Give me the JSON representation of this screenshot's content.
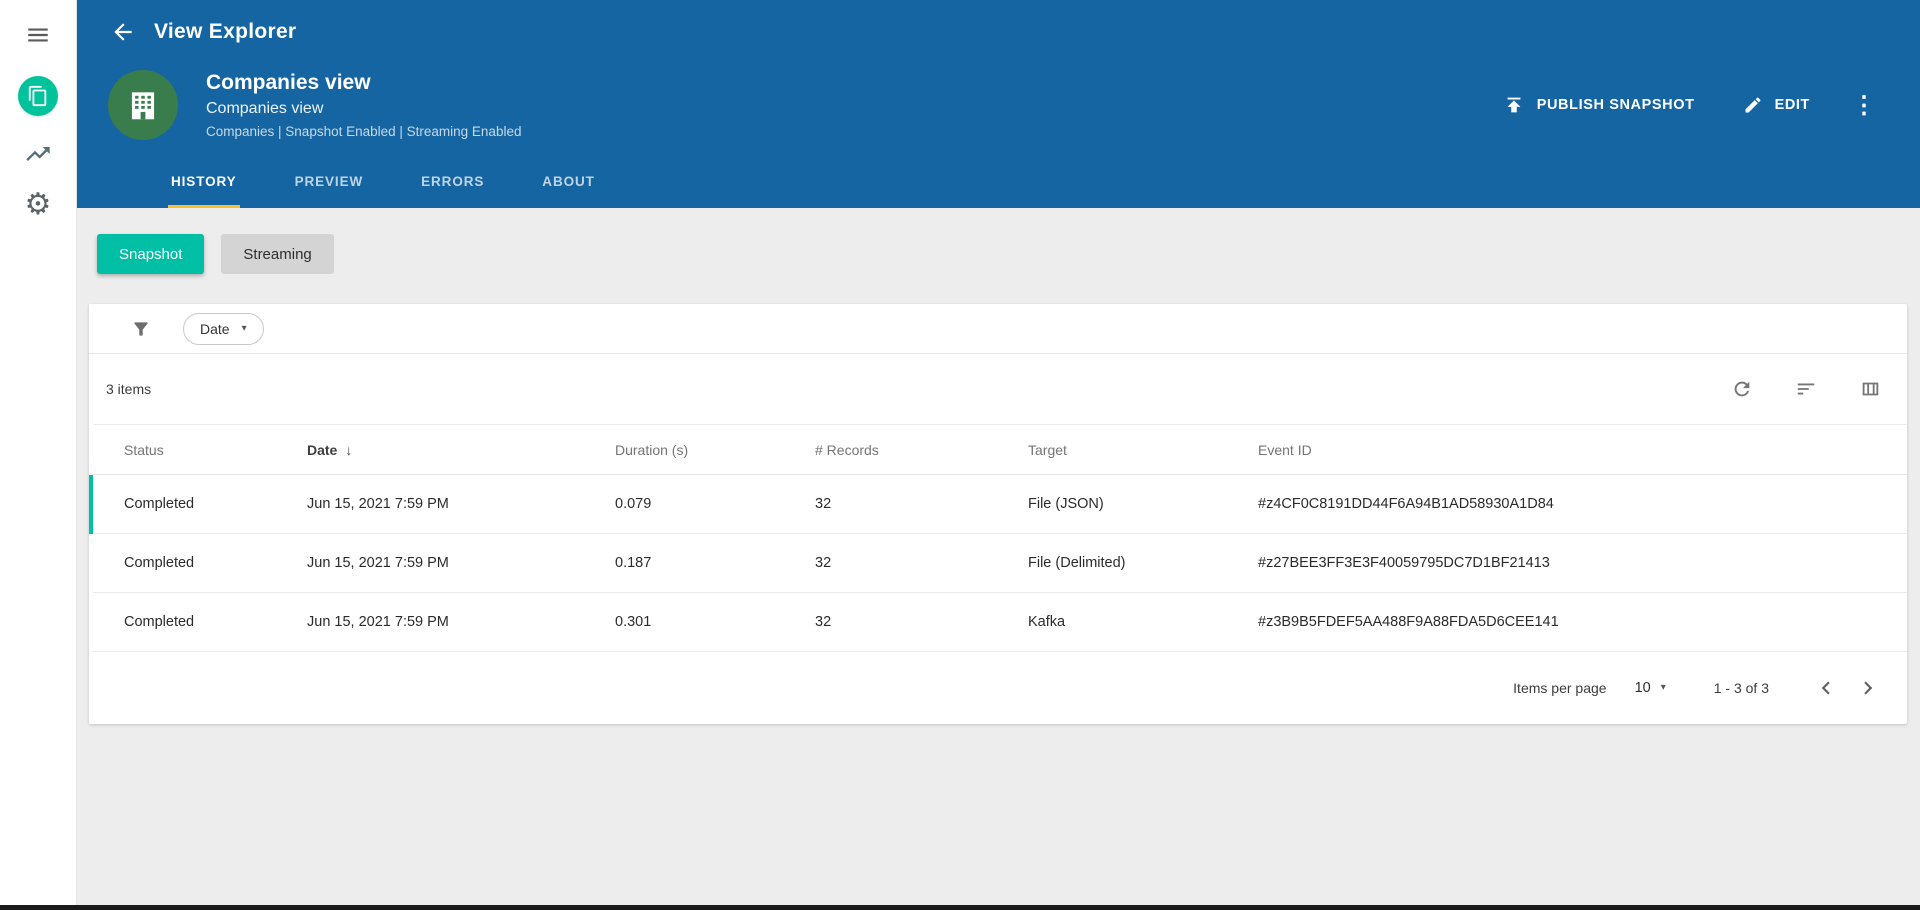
{
  "colors": {
    "header_blue": "#1565a3",
    "accent_teal": "#00bfa5",
    "tab_underline_yellow": "#fbc02d",
    "avatar_green": "#3a7d4c",
    "selected_row_indicator": "#00bfa5"
  },
  "glyphs": {
    "gear": "⚙",
    "kebab": "⋮",
    "caret_down": "▾",
    "sort_desc": "↓"
  },
  "header": {
    "app_title": "View Explorer",
    "view_name": "Companies view",
    "view_subtitle": "Companies view",
    "view_meta": "Companies | Snapshot Enabled | Streaming Enabled",
    "actions": {
      "publish_label": "PUBLISH SNAPSHOT",
      "edit_label": "EDIT"
    },
    "tabs": [
      {
        "label": "HISTORY"
      },
      {
        "label": "PREVIEW"
      },
      {
        "label": "ERRORS"
      },
      {
        "label": "ABOUT"
      }
    ]
  },
  "toggles": {
    "snapshot": "Snapshot",
    "streaming": "Streaming"
  },
  "filter": {
    "chip_label": "Date"
  },
  "table": {
    "items_summary": "3 items",
    "columns": {
      "status": "Status",
      "date": "Date",
      "duration": "Duration (s)",
      "records": "# Records",
      "target": "Target",
      "event_id": "Event ID"
    },
    "sorted_column": "Date",
    "rows": [
      {
        "status": "Completed",
        "date": "Jun 15, 2021 7:59 PM",
        "duration": "0.079",
        "records": "32",
        "target": "File (JSON)",
        "event_id": "#z4CF0C8191DD44F6A94B1AD58930A1D84"
      },
      {
        "status": "Completed",
        "date": "Jun 15, 2021 7:59 PM",
        "duration": "0.187",
        "records": "32",
        "target": "File (Delimited)",
        "event_id": "#z27BEE3FF3E3F40059795DC7D1BF21413"
      },
      {
        "status": "Completed",
        "date": "Jun 15, 2021 7:59 PM",
        "duration": "0.301",
        "records": "32",
        "target": "Kafka",
        "event_id": "#z3B9B5FDEF5AA488F9A88FDA5D6CEE141"
      }
    ]
  },
  "pagination": {
    "items_per_page_label": "Items per page",
    "page_size": "10",
    "range_label": "1 - 3 of 3"
  }
}
